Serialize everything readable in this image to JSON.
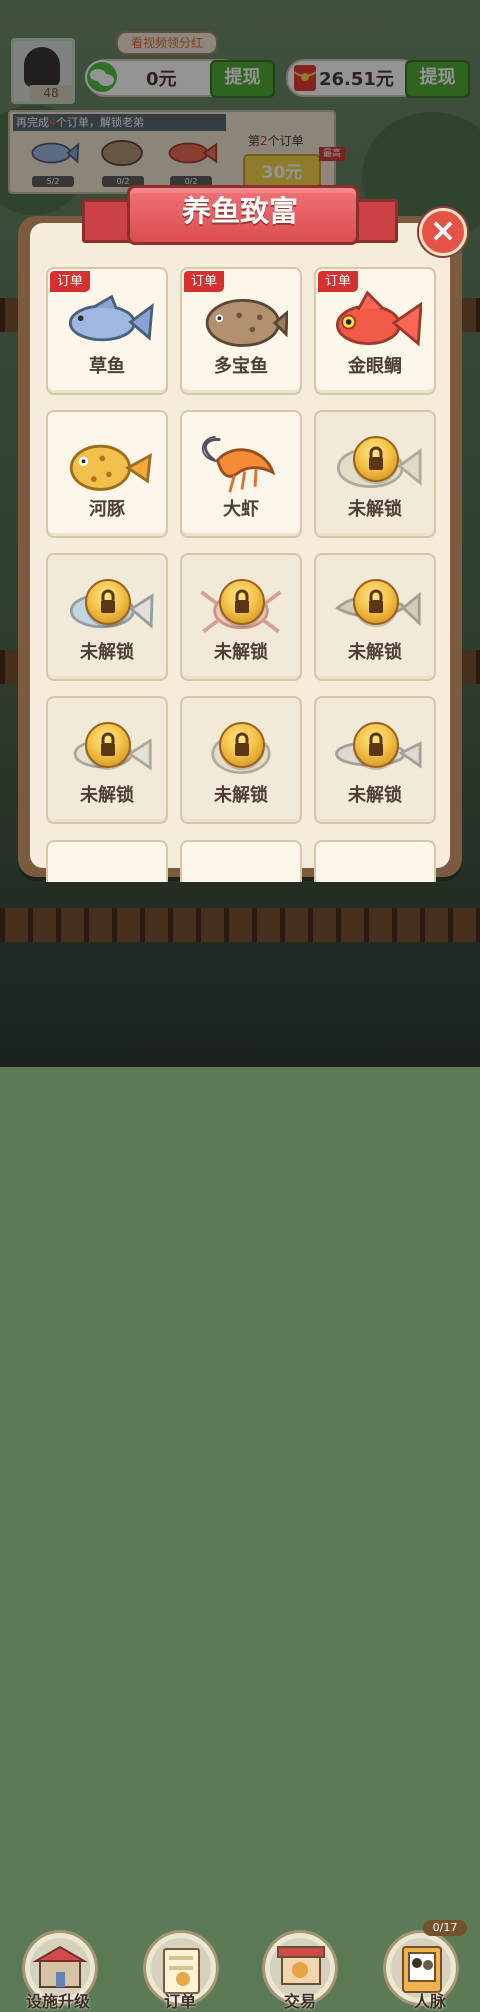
{
  "top": {
    "avatar_level": "48",
    "video_bonus": "看视频领分红",
    "wechat_balance": "0元",
    "red_balance": "26.51元",
    "withdraw_label": "提现"
  },
  "orders": {
    "hint_prefix": "再完成",
    "hint_count": "4",
    "hint_suffix": "个订单，解锁老弟",
    "items": [
      "5/2",
      "0/2",
      "0/2"
    ],
    "title_prefix": "第",
    "title_number": "2",
    "title_suffix": "个订单",
    "reward": "30元",
    "best_badge": "最高"
  },
  "modal": {
    "title": "养鱼致富",
    "close_icon": "close-icon",
    "cards": [
      {
        "label": "草鱼",
        "order_tag": "订单",
        "locked": false,
        "icon": "grass-carp-icon"
      },
      {
        "label": "多宝鱼",
        "order_tag": "订单",
        "locked": false,
        "icon": "turbot-icon"
      },
      {
        "label": "金眼鲷",
        "order_tag": "订单",
        "locked": false,
        "icon": "golden-eye-snapper-icon"
      },
      {
        "label": "河豚",
        "locked": false,
        "icon": "puffer-fish-icon"
      },
      {
        "label": "大虾",
        "locked": false,
        "icon": "shrimp-icon"
      },
      {
        "label": "未解锁",
        "locked": true,
        "icon": "locked-grouper-icon"
      },
      {
        "label": "未解锁",
        "locked": true,
        "icon": "locked-fish-icon"
      },
      {
        "label": "未解锁",
        "locked": true,
        "icon": "locked-crab-icon"
      },
      {
        "label": "未解锁",
        "locked": true,
        "icon": "locked-catfish-icon"
      },
      {
        "label": "未解锁",
        "locked": true,
        "icon": "locked-small-fish-icon"
      },
      {
        "label": "未解锁",
        "locked": true,
        "icon": "locked-turtle-icon"
      },
      {
        "label": "未解锁",
        "locked": true,
        "icon": "locked-long-fish-icon"
      }
    ]
  },
  "bottom_nav": {
    "items": [
      {
        "label": "设施升级",
        "icon": "facility-icon"
      },
      {
        "label": "订单",
        "icon": "order-icon"
      },
      {
        "label": "交易",
        "icon": "trade-icon"
      },
      {
        "label": "人脉",
        "icon": "contacts-icon",
        "badge": "0/17"
      }
    ]
  },
  "colors": {
    "modal_red": "#e05759",
    "order_red": "#d7312f",
    "green_button": "#53a938",
    "lock_gold": "#f3c347"
  }
}
